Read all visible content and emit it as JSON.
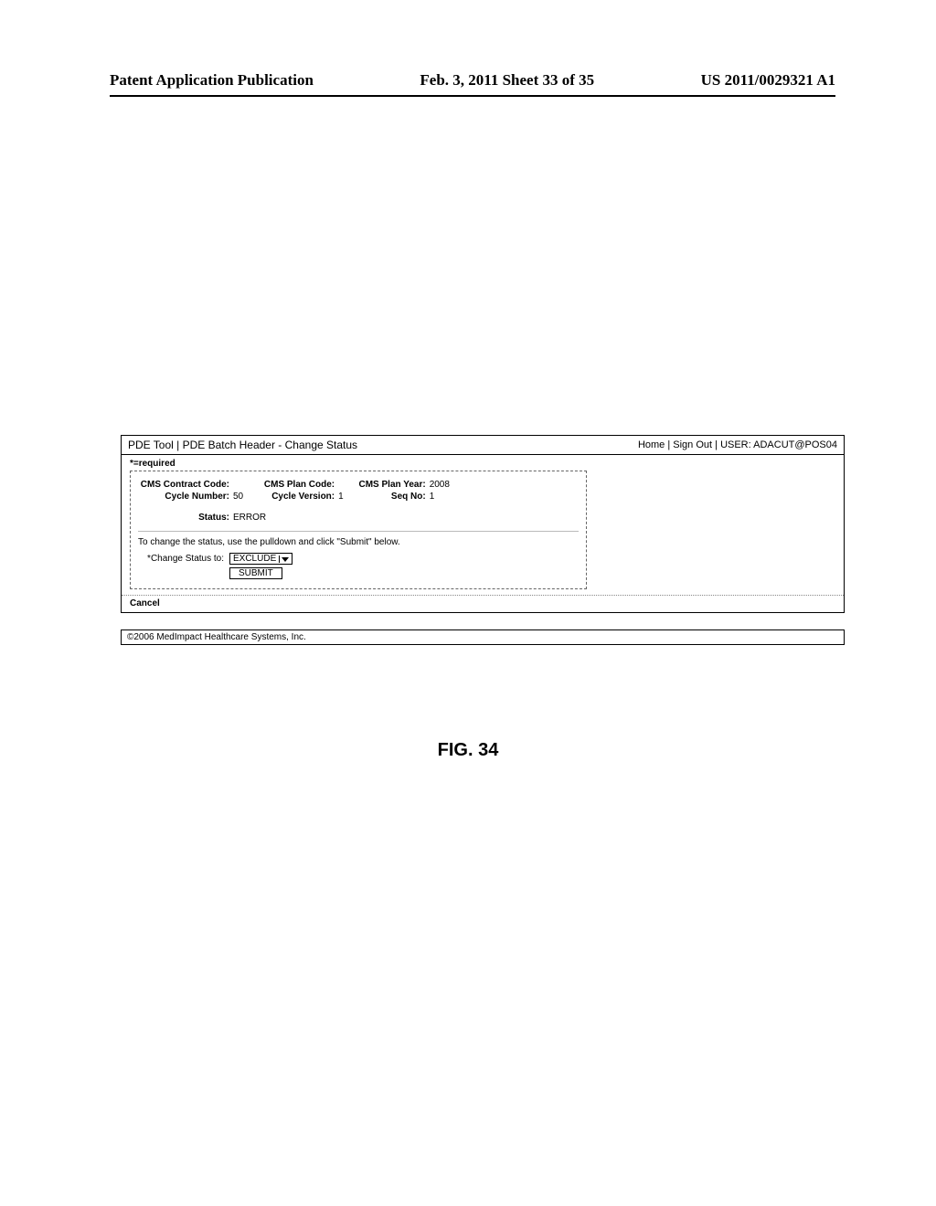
{
  "header": {
    "left": "Patent Application Publication",
    "center": "Feb. 3, 2011  Sheet 33 of 35",
    "right": "US 2011/0029321 A1"
  },
  "titlebar": {
    "left": "PDE Tool | PDE Batch Header - Change Status",
    "home": "Home",
    "signout": "Sign Out",
    "user_prefix": "USER:",
    "user": "ADACUT@POS04"
  },
  "required": "*=required",
  "info": {
    "contract_code": {
      "label": "CMS Contract Code:",
      "value": ""
    },
    "cycle_number": {
      "label": "Cycle Number:",
      "value": "50"
    },
    "plan_code": {
      "label": "CMS Plan Code:",
      "value": ""
    },
    "cycle_version": {
      "label": "Cycle Version:",
      "value": "1"
    },
    "plan_year": {
      "label": "CMS Plan Year:",
      "value": "2008"
    },
    "seq_no": {
      "label": "Seq No:",
      "value": "1"
    },
    "status": {
      "label": "Status:",
      "value": "ERROR"
    }
  },
  "change": {
    "instruction": "To change the status, use the pulldown and click \"Submit\" below.",
    "label": "*Change Status to:",
    "selected": "EXCLUDE",
    "submit": "SUBMIT"
  },
  "cancel": "Cancel",
  "copyright": "©2006 MedImpact Healthcare Systems, Inc.",
  "figure_label": "FIG. 34"
}
